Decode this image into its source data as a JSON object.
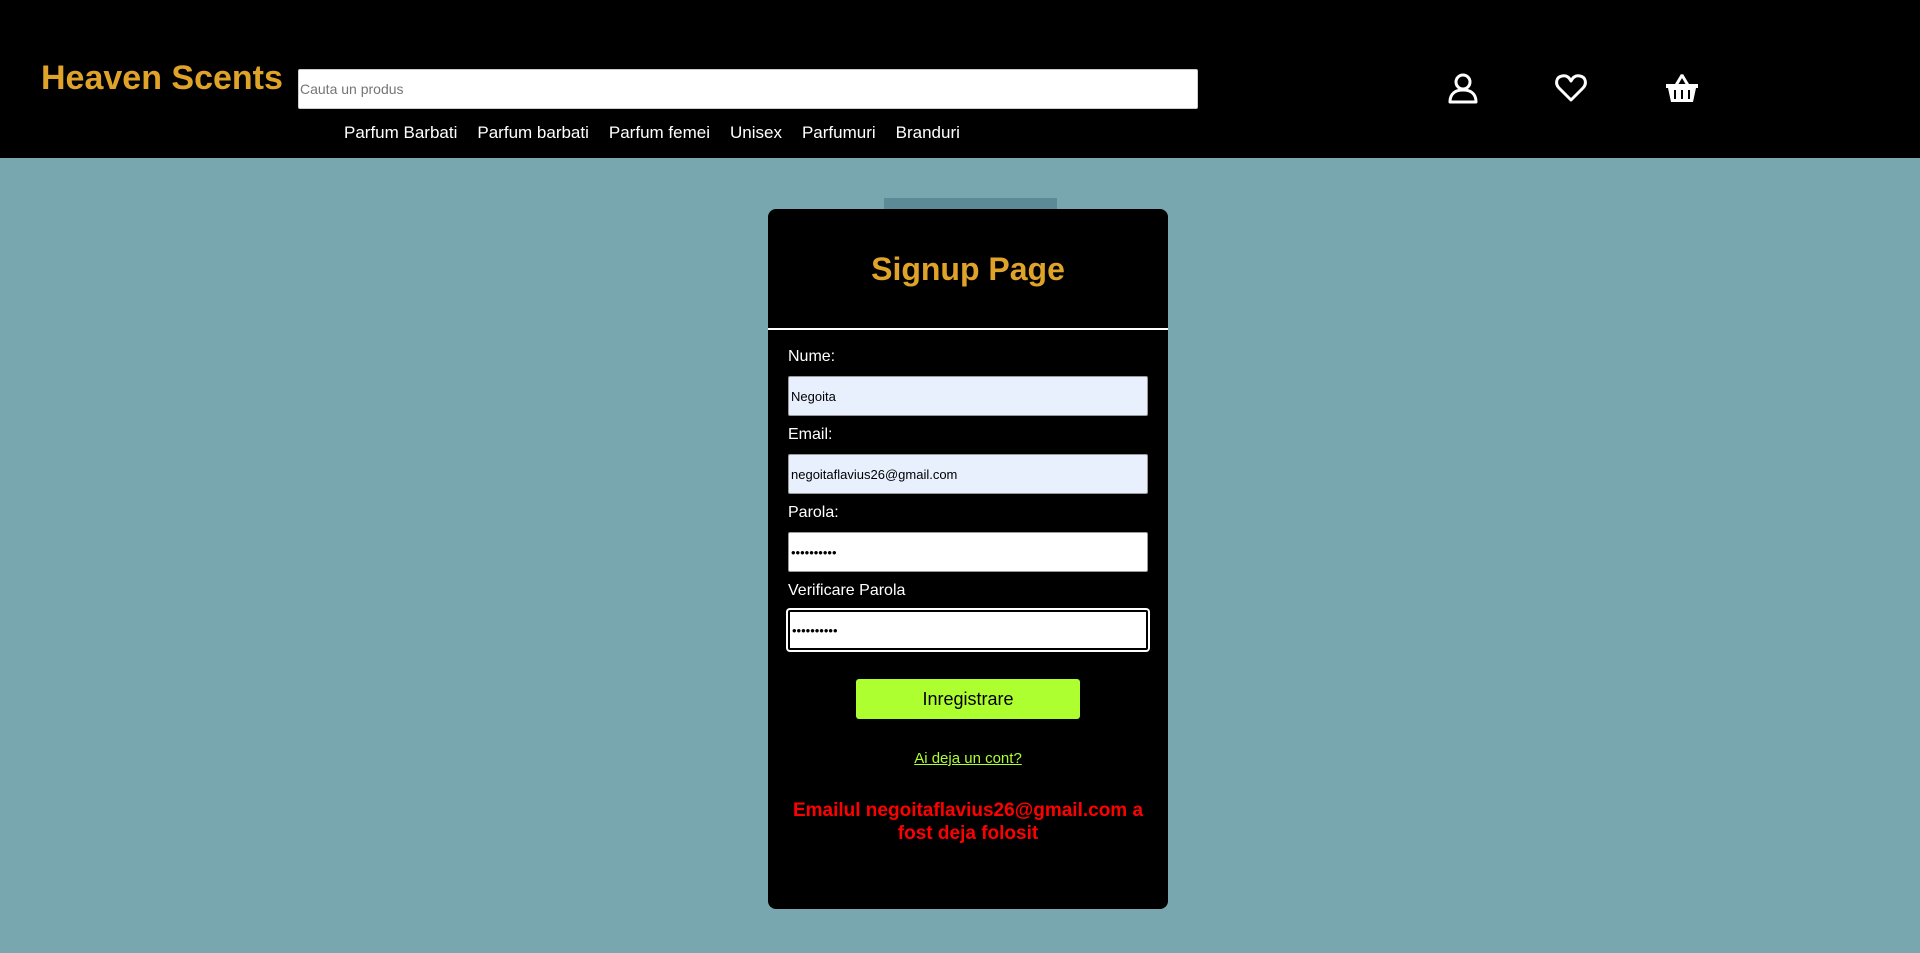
{
  "header": {
    "logo": "Heaven Scents",
    "search": {
      "placeholder": "Cauta un produs",
      "value": ""
    },
    "nav": [
      {
        "label": "Parfum Barbati"
      },
      {
        "label": "Parfum barbati"
      },
      {
        "label": "Parfum femei"
      },
      {
        "label": "Unisex"
      },
      {
        "label": "Parfumuri"
      },
      {
        "label": "Branduri"
      }
    ],
    "icons": [
      "user-icon",
      "heart-icon",
      "basket-icon"
    ]
  },
  "signup": {
    "title": "Signup Page",
    "fields": {
      "name": {
        "label": "Nume:",
        "value": "Negoita"
      },
      "email": {
        "label": "Email:",
        "value": "negoitaflavius26@gmail.com"
      },
      "password": {
        "label": "Parola:",
        "value": "••••••••••"
      },
      "confirm": {
        "label": "Verificare Parola",
        "value": "••••••••••"
      }
    },
    "submit_label": "Inregistrare",
    "login_link": "Ai deja un cont?",
    "error": "Emailul negoitaflavius26@gmail.com a fost deja folosit"
  },
  "colors": {
    "page_bg": "#79a7b0",
    "header_bg": "#000000",
    "brand": "#e0a32a",
    "accent": "#adff2f",
    "error": "#ff0000"
  }
}
